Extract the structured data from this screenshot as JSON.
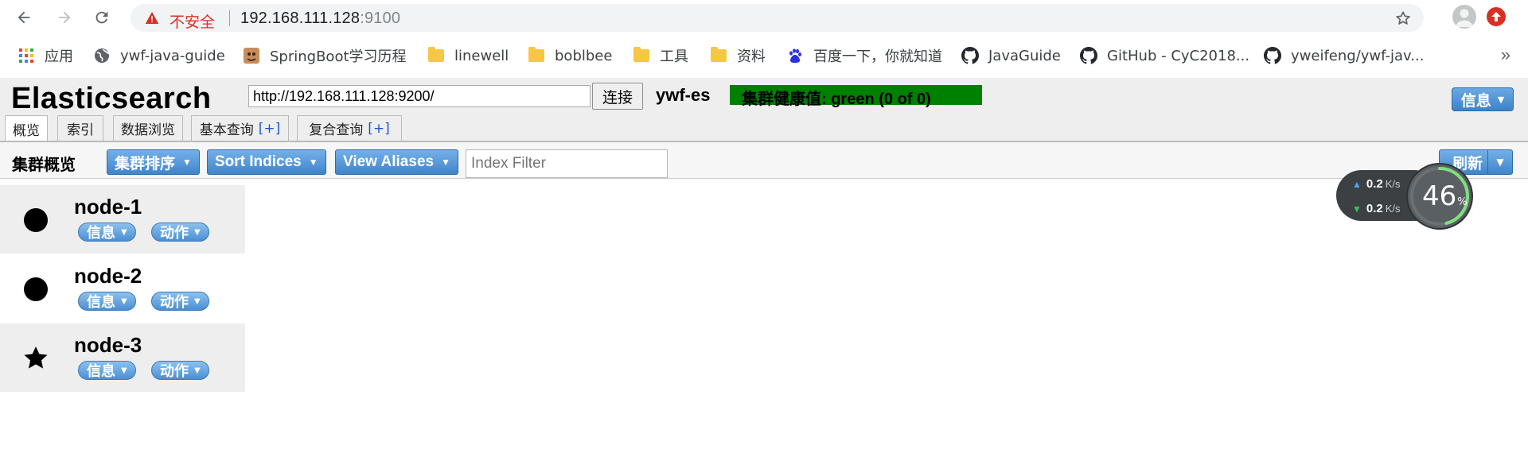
{
  "browser": {
    "insecure_label": "不安全",
    "url_host": "192.168.111.128",
    "url_port": ":9100"
  },
  "bookmarks": [
    {
      "label": "应用",
      "icon": "apps-grid-icon"
    },
    {
      "label": "ywf-java-guide",
      "icon": "globe-icon"
    },
    {
      "label": "SpringBoot学习历程",
      "icon": "site-favicon-icon"
    },
    {
      "label": "linewell",
      "icon": "folder-icon"
    },
    {
      "label": "boblbee",
      "icon": "folder-icon"
    },
    {
      "label": "工具",
      "icon": "folder-icon"
    },
    {
      "label": "资料",
      "icon": "folder-icon"
    },
    {
      "label": "百度一下，你就知道",
      "icon": "baidu-paw-icon"
    },
    {
      "label": "JavaGuide",
      "icon": "github-icon"
    },
    {
      "label": "GitHub - CyC2018...",
      "icon": "github-icon"
    },
    {
      "label": "yweifeng/ywf-jav...",
      "icon": "github-icon"
    }
  ],
  "app": {
    "title": "Elasticsearch",
    "connect_url": "http://192.168.111.128:9200/",
    "connect_label": "连接",
    "cluster_name": "ywf-es",
    "health_text": "集群健康值: green (0 of 0)",
    "health_color": "#008000",
    "info_label": "信息"
  },
  "tabs": [
    {
      "label": "概览",
      "plus": ""
    },
    {
      "label": "索引",
      "plus": ""
    },
    {
      "label": "数据浏览",
      "plus": ""
    },
    {
      "label": "基本查询",
      "plus": "[+]"
    },
    {
      "label": "复合查询",
      "plus": "[+]"
    }
  ],
  "toolbar": {
    "title": "集群概览",
    "sort_cluster_label": "集群排序",
    "sort_indices_label": "Sort Indices",
    "view_aliases_label": "View Aliases",
    "filter_placeholder": "Index Filter",
    "refresh_label": "刷新"
  },
  "nodes": [
    {
      "name": "node-1",
      "marker": "circle",
      "info_label": "信息",
      "action_label": "动作"
    },
    {
      "name": "node-2",
      "marker": "circle",
      "info_label": "信息",
      "action_label": "动作"
    },
    {
      "name": "node-3",
      "marker": "star",
      "info_label": "信息",
      "action_label": "动作"
    }
  ],
  "network_widget": {
    "upload": "0.2",
    "download": "0.2",
    "unit": "K/s",
    "percent": "46",
    "percent_sign": "%",
    "percent_value": 46
  },
  "colors": {
    "accent_blue": "#3f85cb",
    "insecure_red": "#d93025"
  }
}
